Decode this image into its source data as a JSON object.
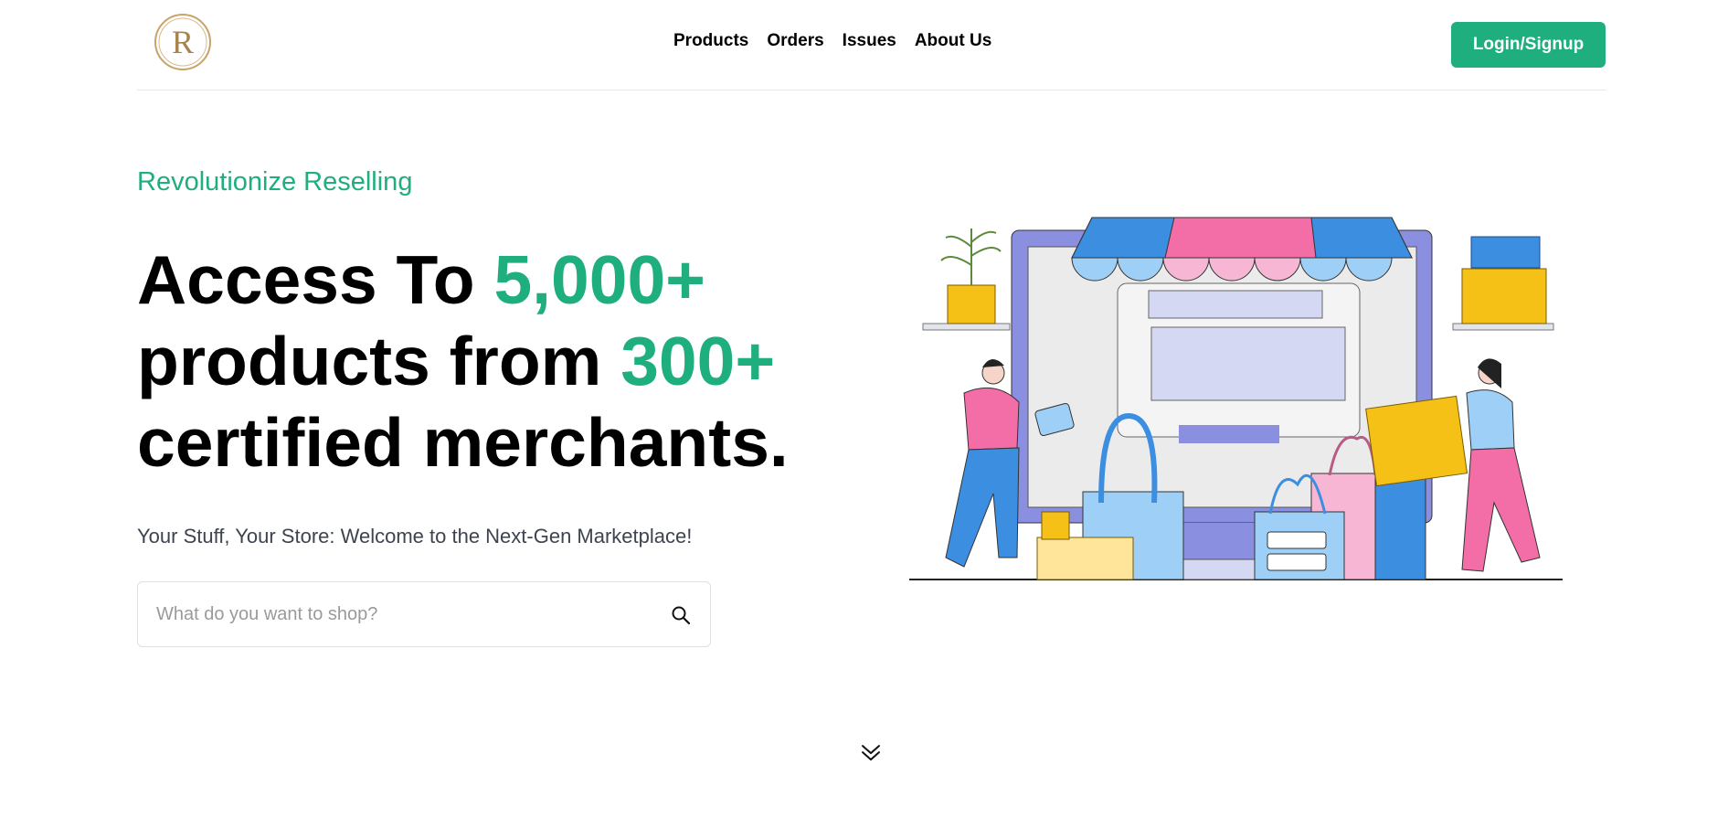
{
  "header": {
    "logo_letter": "R",
    "nav": [
      {
        "label": "Products"
      },
      {
        "label": "Orders"
      },
      {
        "label": "Issues"
      },
      {
        "label": "About Us"
      }
    ],
    "login_label": "Login/Signup"
  },
  "hero": {
    "eyebrow": "Revolutionize Reselling",
    "headline": {
      "line1_text": "Access To ",
      "line1_accent": "5,000+",
      "line2_text": "products from ",
      "line2_accent": "300+",
      "line3_text": "certified merchants."
    },
    "subtitle": "Your Stuff, Your Store: Welcome to the Next-Gen Marketplace!",
    "search": {
      "placeholder": "What do you want to shop?",
      "value": ""
    }
  },
  "colors": {
    "accent": "#1fae7e",
    "text": "#000000",
    "subtitle": "#3d4450"
  },
  "icons": {
    "search": "search-icon",
    "scroll": "double-chevron-down-icon"
  }
}
